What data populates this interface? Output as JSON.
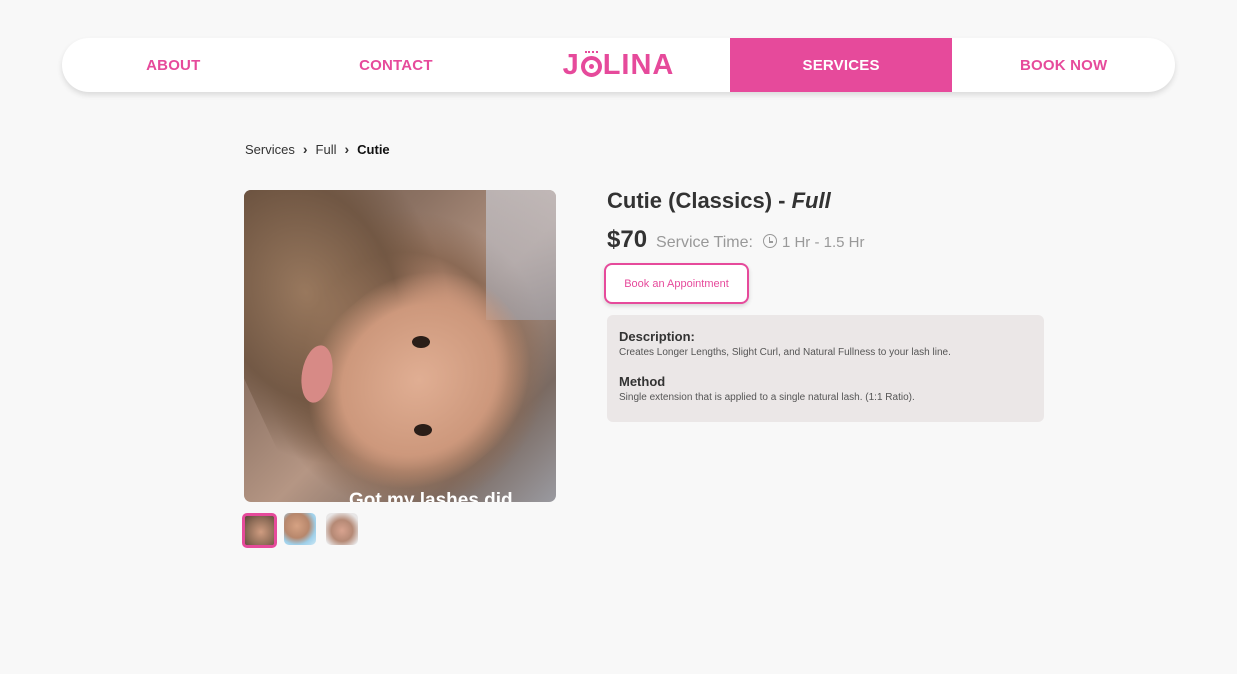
{
  "nav": {
    "about": "ABOUT",
    "contact": "CONTACT",
    "logo_pre": "J",
    "logo_post": "LINA",
    "services": "SERVICES",
    "book_now": "BOOK NOW"
  },
  "breadcrumb": {
    "items": [
      "Services",
      "Full",
      "Cutie"
    ]
  },
  "product": {
    "title_main": "Cutie (Classics) - ",
    "title_variant": "Full",
    "price": "$70",
    "service_time_label": "Service Time:",
    "service_time_value": "1 Hr - 1.5 Hr",
    "book_button": "Book an Appointment",
    "image_caption": "Got my lashes did"
  },
  "details": {
    "description_heading": "Description:",
    "description_text": "Creates Longer Lengths, Slight Curl, and Natural Fullness to your lash line.",
    "method_heading": "Method",
    "method_text": "Single extension that is applied to a single natural lash. (1:1 Ratio)."
  },
  "colors": {
    "accent": "#e64a9b",
    "background": "#f8f8f8",
    "info_box": "#ebe7e7"
  }
}
